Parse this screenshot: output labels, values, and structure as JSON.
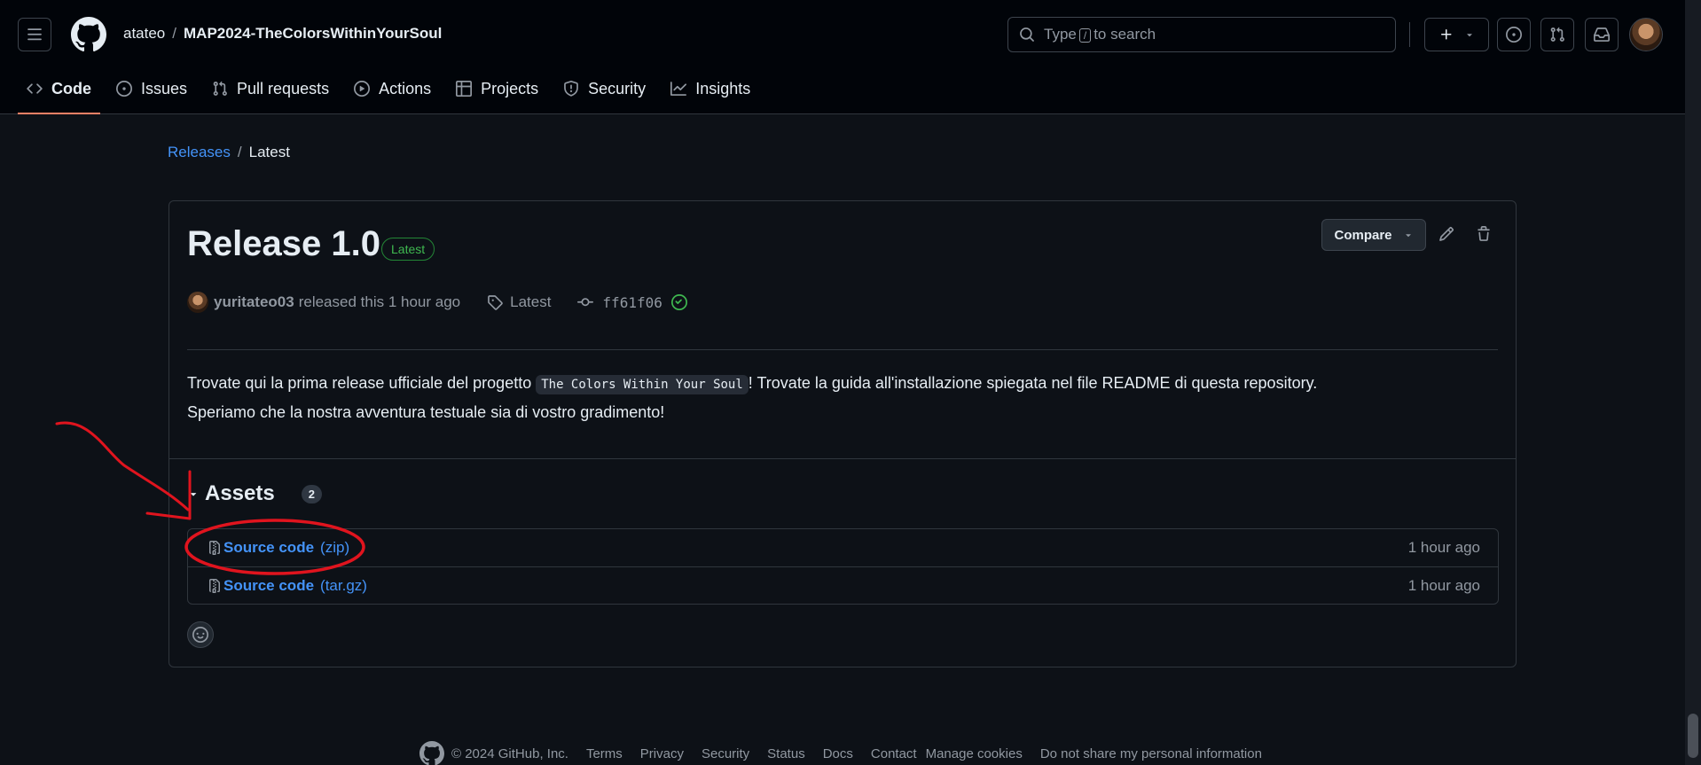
{
  "header": {
    "owner": "atateo",
    "separator": "/",
    "repo": "MAP2024-TheColorsWithinYourSoul",
    "search": {
      "prefix": "Type",
      "key": "/",
      "suffix": "to search"
    },
    "icons": [
      "menu-icon",
      "github-logo",
      "search-icon",
      "plus-icon",
      "caret-down-icon",
      "issue-icon",
      "pull-request-icon",
      "inbox-icon",
      "avatar"
    ]
  },
  "tabs": [
    {
      "label": "Code",
      "icon": "code-icon",
      "active": true
    },
    {
      "label": "Issues",
      "icon": "issue-icon"
    },
    {
      "label": "Pull requests",
      "icon": "pull-request-icon"
    },
    {
      "label": "Actions",
      "icon": "play-icon"
    },
    {
      "label": "Projects",
      "icon": "table-icon"
    },
    {
      "label": "Security",
      "icon": "shield-icon"
    },
    {
      "label": "Insights",
      "icon": "graph-icon"
    }
  ],
  "breadcrumb": {
    "parent": "Releases",
    "separator": "/",
    "current": "Latest"
  },
  "release": {
    "title": "Release 1.0",
    "badge": "Latest",
    "compare_label": "Compare",
    "author": "yuritateo03",
    "released_text": "released this 1 hour ago",
    "tag": "Latest",
    "commit": "ff61f06",
    "body_before": "Trovate qui la prima release ufficiale del progetto ",
    "body_code": "The Colors Within Your Soul",
    "body_after": "! Trovate la guida all'installazione spiegata nel file README di questa repository.",
    "body_line2": "Speriamo che la nostra avventura testuale sia di vostro gradimento!"
  },
  "assets": {
    "heading": "Assets",
    "count": "2",
    "items": [
      {
        "label": "Source code",
        "ext": "(zip)",
        "time": "1 hour ago"
      },
      {
        "label": "Source code",
        "ext": "(tar.gz)",
        "time": "1 hour ago"
      }
    ]
  },
  "footer": {
    "copyright": "© 2024 GitHub, Inc.",
    "links": [
      "Terms",
      "Privacy",
      "Security",
      "Status",
      "Docs",
      "Contact",
      "Manage cookies",
      "Do not share my personal information"
    ]
  },
  "colors": {
    "background": "#0d1117",
    "header_bg": "#010409",
    "link": "#4493f8",
    "accent_tab": "#f78166",
    "latest_green": "#3fb950",
    "annotation_red": "#e0141e"
  }
}
